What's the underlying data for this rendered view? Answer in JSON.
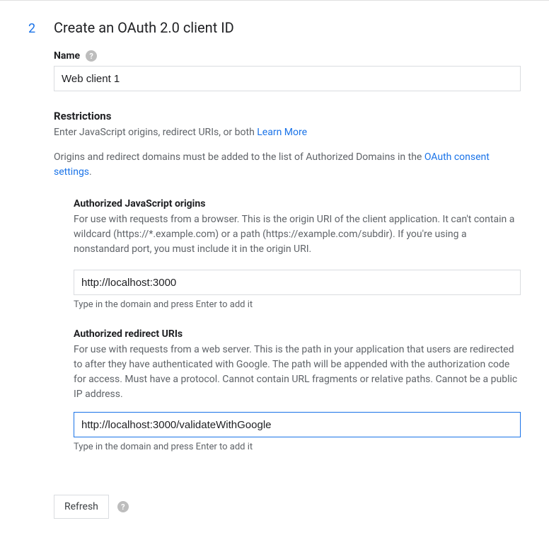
{
  "step": {
    "number": "2",
    "title": "Create an OAuth 2.0 client ID"
  },
  "name": {
    "label": "Name",
    "value": "Web client 1"
  },
  "restrictions": {
    "heading": "Restrictions",
    "desc_prefix": "Enter JavaScript origins, redirect URIs, or both ",
    "learn_more": "Learn More",
    "domains_desc_prefix": "Origins and redirect domains must be added to the list of Authorized Domains in the ",
    "consent_link": "OAuth consent settings",
    "domains_desc_suffix": "."
  },
  "js_origins": {
    "label": "Authorized JavaScript origins",
    "desc": "For use with requests from a browser. This is the origin URI of the client application. It can't contain a wildcard (https://*.example.com) or a path (https://example.com/subdir). If you're using a nonstandard port, you must include it in the origin URI.",
    "value": "http://localhost:3000",
    "hint": "Type in the domain and press Enter to add it"
  },
  "redirect_uris": {
    "label": "Authorized redirect URIs",
    "desc": "For use with requests from a web server. This is the path in your application that users are redirected to after they have authenticated with Google. The path will be appended with the authorization code for access. Must have a protocol. Cannot contain URL fragments or relative paths. Cannot be a public IP address.",
    "value": "http://localhost:3000/validateWithGoogle",
    "hint": "Type in the domain and press Enter to add it"
  },
  "footer": {
    "refresh": "Refresh"
  },
  "help_glyph": "?"
}
